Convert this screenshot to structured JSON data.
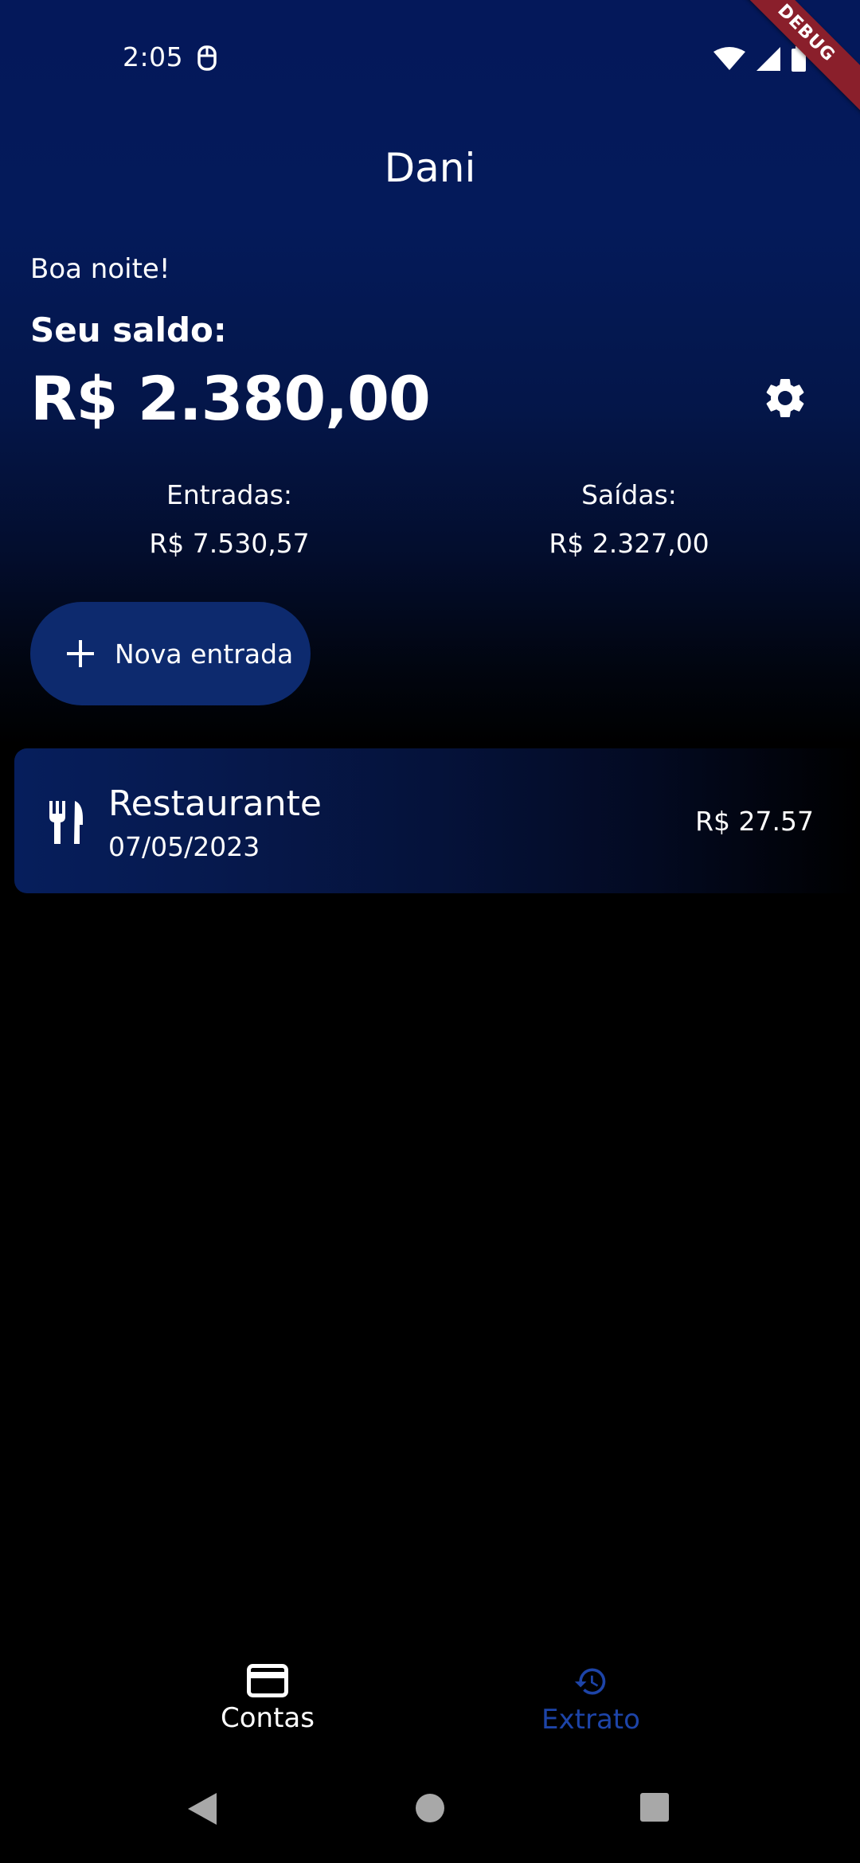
{
  "status_bar": {
    "time": "2:05",
    "debug_banner": "DEBUG"
  },
  "header": {
    "title": "Dani",
    "greeting": "Boa noite!",
    "balance_label": "Seu saldo:",
    "balance_value": "R$ 2.380,00"
  },
  "summary": {
    "income_label": "Entradas:",
    "income_value": "R$ 7.530,57",
    "expense_label": "Saídas:",
    "expense_value": "R$ 2.327,00"
  },
  "actions": {
    "new_entry_label": "Nova entrada"
  },
  "transactions": [
    {
      "icon": "restaurant-icon",
      "title": "Restaurante",
      "date": "07/05/2023",
      "amount": "R$ 27.57"
    }
  ],
  "bottom_nav": {
    "items": [
      {
        "label": "Contas",
        "icon": "credit-card-icon",
        "active": false
      },
      {
        "label": "Extrato",
        "icon": "history-icon",
        "active": true
      }
    ]
  },
  "colors": {
    "background_top": "#04185a",
    "background_bottom": "#000000",
    "button_bg": "#0d2a6e",
    "active_nav": "#1d44a8",
    "debug_banner": "#8a1f2b"
  }
}
